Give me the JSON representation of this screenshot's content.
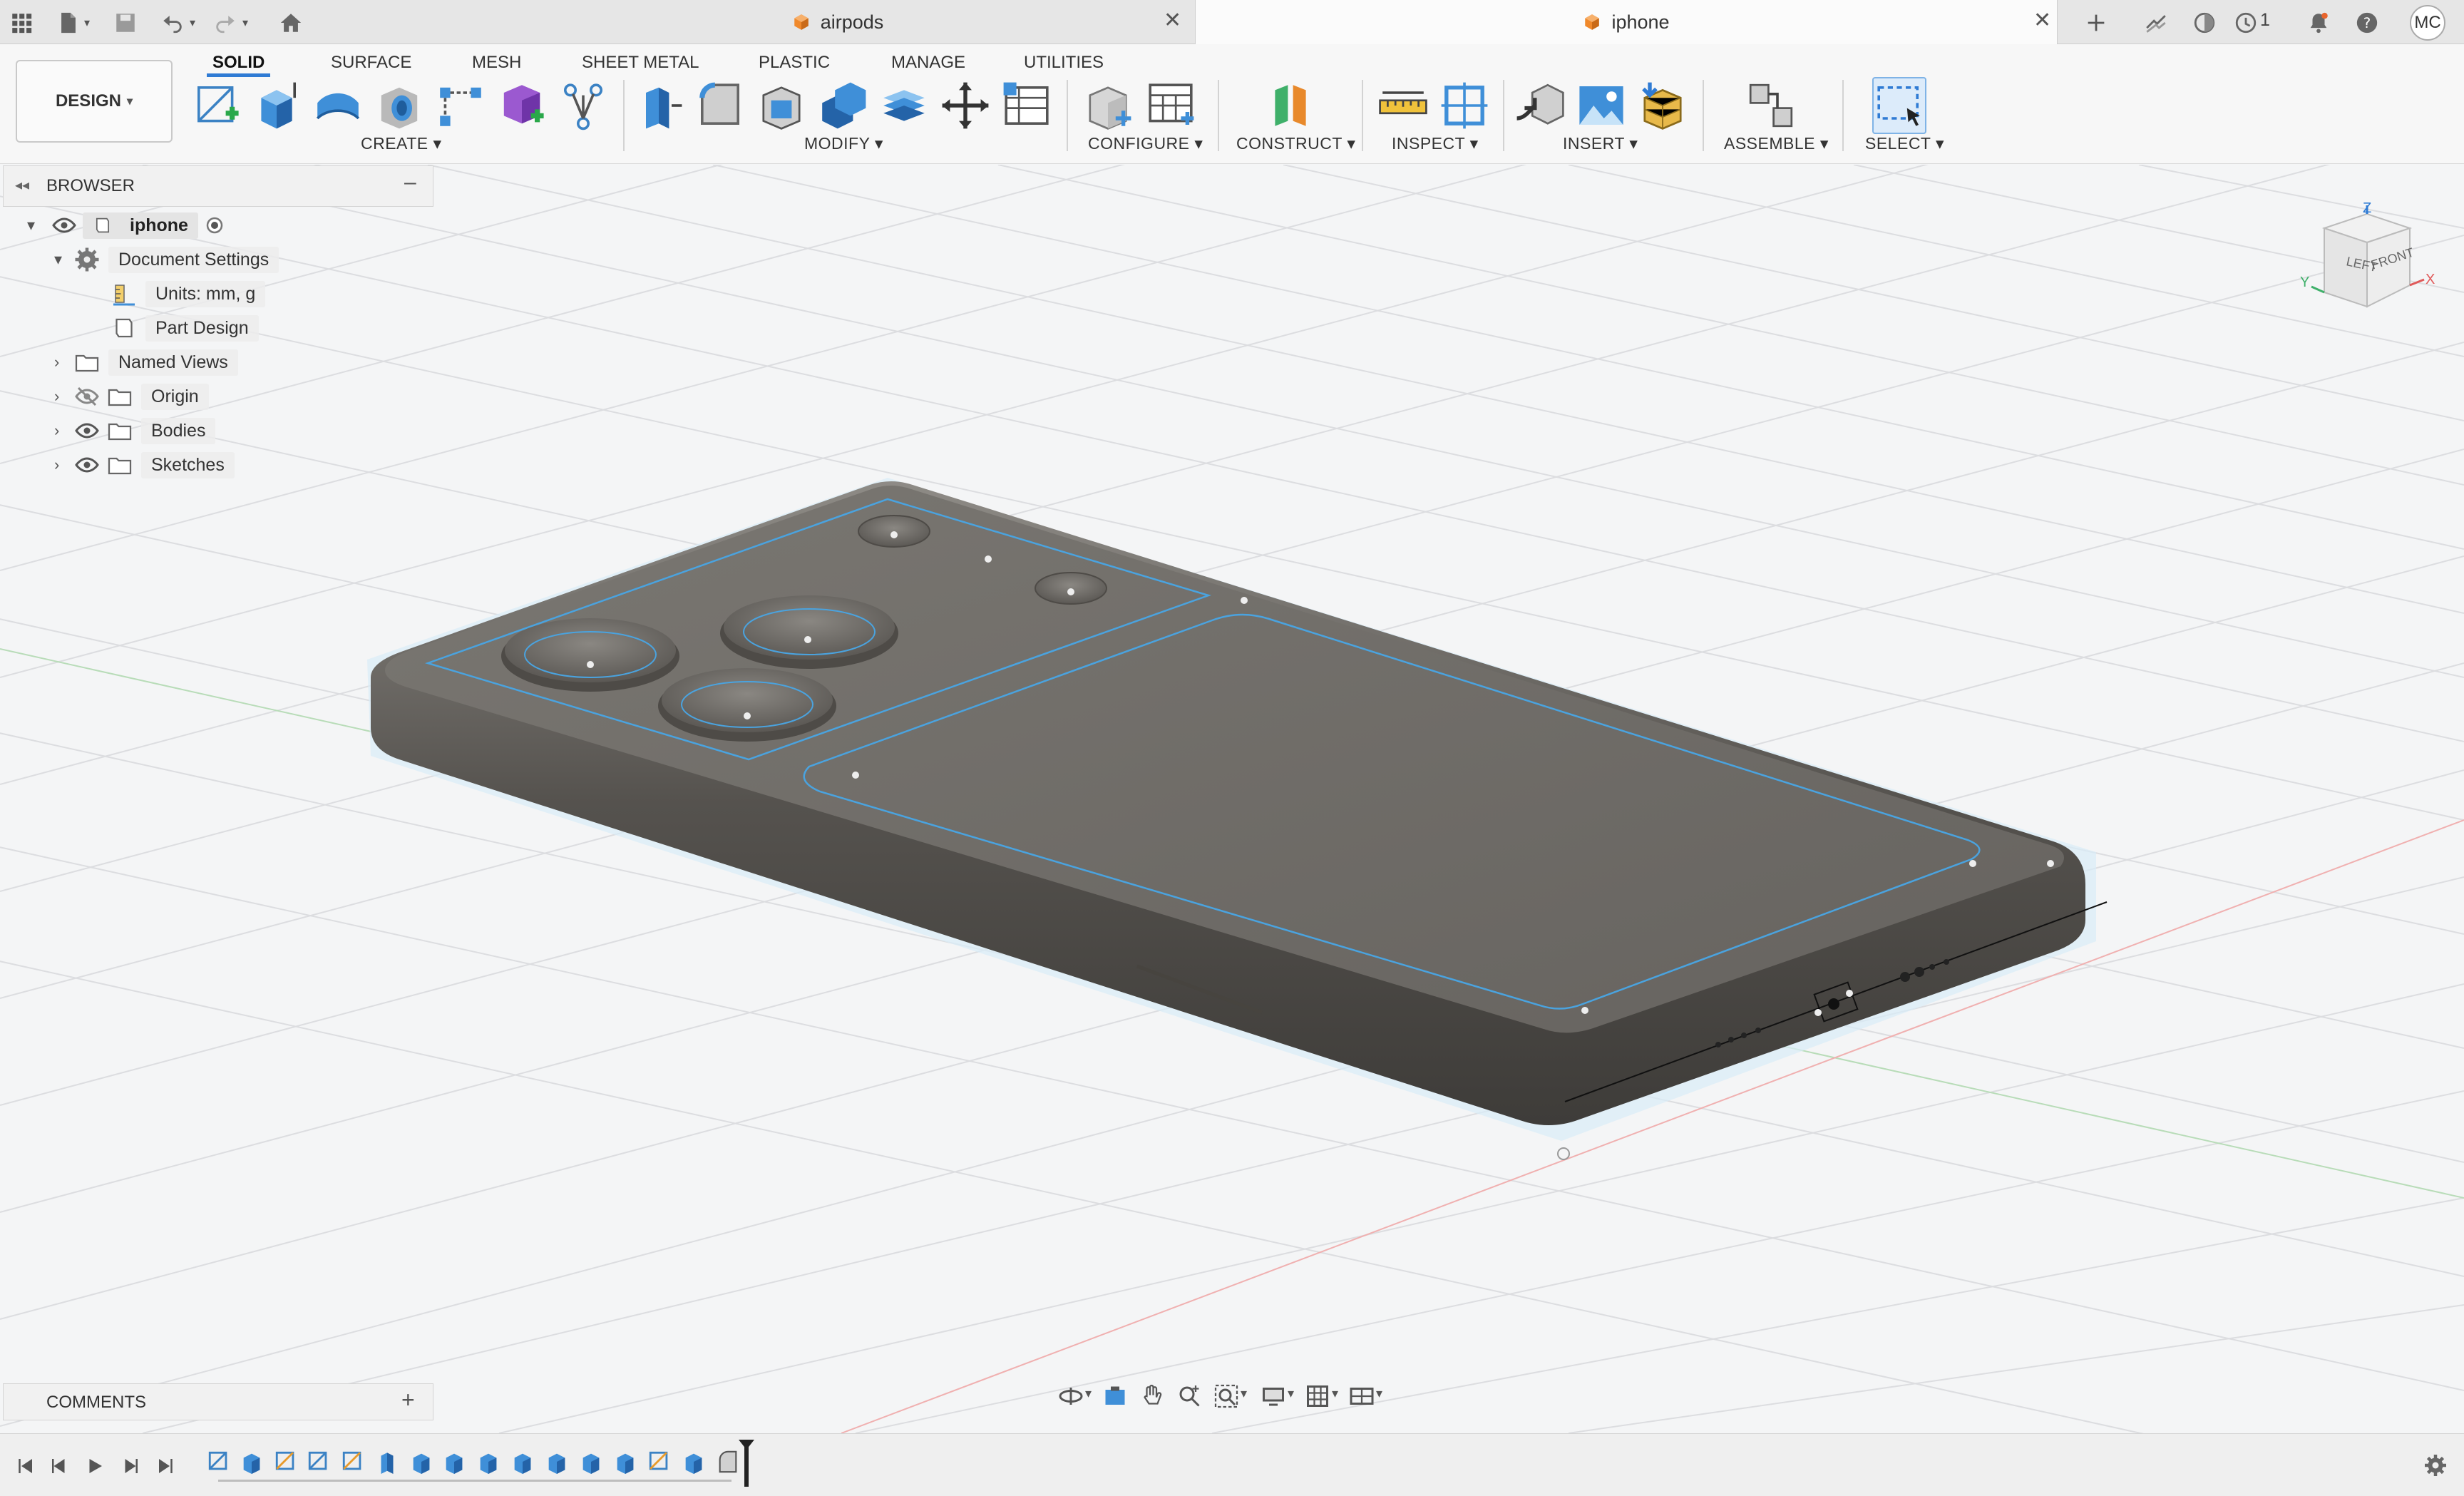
{
  "tabs": {
    "items": [
      {
        "label": "airpods",
        "active": false
      },
      {
        "label": "iphone",
        "active": true
      }
    ]
  },
  "header": {
    "notification_count": "1",
    "user_initials": "MC"
  },
  "workspace": {
    "mode_label": "DESIGN",
    "tabs": [
      "SOLID",
      "SURFACE",
      "MESH",
      "SHEET METAL",
      "PLASTIC",
      "MANAGE",
      "UTILITIES"
    ],
    "active_tab": "SOLID",
    "groups": {
      "create": "CREATE",
      "modify": "MODIFY",
      "configure": "CONFIGURE",
      "construct": "CONSTRUCT",
      "inspect": "INSPECT",
      "insert": "INSERT",
      "assemble": "ASSEMBLE",
      "select": "SELECT"
    }
  },
  "browser": {
    "title": "BROWSER",
    "root": "iphone",
    "document_settings": "Document Settings",
    "units": "Units: mm, g",
    "part_design": "Part Design",
    "named_views": "Named Views",
    "origin": "Origin",
    "bodies": "Bodies",
    "sketches": "Sketches"
  },
  "comments": {
    "title": "COMMENTS"
  },
  "viewcube": {
    "top": "Z",
    "left": "LEFT",
    "front": "FRONT",
    "x": "X",
    "y": "Y"
  },
  "colors": {
    "accent": "#2f7bd4",
    "body": "#6e6b66",
    "sketch_line": "#4aa3df",
    "orange_cube": "#f0892b"
  },
  "icons": [
    "grid-icon",
    "file-icon",
    "save-icon",
    "undo-icon",
    "redo-icon",
    "home-icon",
    "plus-icon",
    "extensions-icon",
    "online-icon",
    "jobs-icon",
    "bell-icon",
    "help-icon"
  ]
}
